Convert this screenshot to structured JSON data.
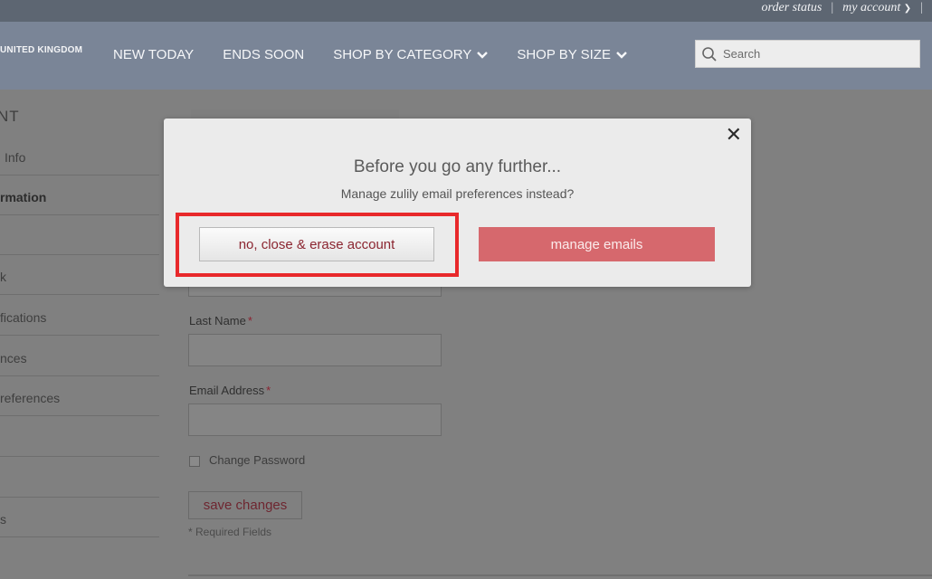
{
  "topbar": {
    "order_status": "order status",
    "separator": "|",
    "my_account": "my account",
    "account_chevron": "chevron-down-icon"
  },
  "brand": {
    "region": "UNITED KINGDOM"
  },
  "nav": {
    "items": [
      {
        "label": "NEW TODAY"
      },
      {
        "label": "ENDS SOON"
      },
      {
        "label": "SHOP BY CATEGORY",
        "icon": "chevron-down-icon"
      },
      {
        "label": "SHOP BY SIZE",
        "icon": "chevron-down-icon"
      }
    ]
  },
  "search": {
    "placeholder": "Search",
    "icon": "search-icon"
  },
  "sidebar": {
    "title": "NT",
    "items": [
      {
        "label": "Info"
      },
      {
        "label": "rmation"
      },
      {
        "label": ""
      },
      {
        "label": "k"
      },
      {
        "label": "fications"
      },
      {
        "label": "nces"
      },
      {
        "label": "references"
      },
      {
        "label": ""
      },
      {
        "label": ""
      },
      {
        "label": "s"
      }
    ]
  },
  "form": {
    "last_name_label": "Last Name",
    "email_label": "Email Address",
    "required_mark": "*",
    "change_password_label": "Change Password",
    "save_button": "save changes",
    "required_note": "* Required Fields"
  },
  "modal": {
    "title": "Before you go any further...",
    "subtitle": "Manage zulily email preferences instead?",
    "close_icon": "close-icon",
    "close_glyph": "✕",
    "erase_button": "no, close & erase account",
    "manage_button": "manage emails"
  },
  "colors": {
    "accent": "#d6686d",
    "highlight": "#e8292b",
    "nav_bg": "#7a8597"
  }
}
